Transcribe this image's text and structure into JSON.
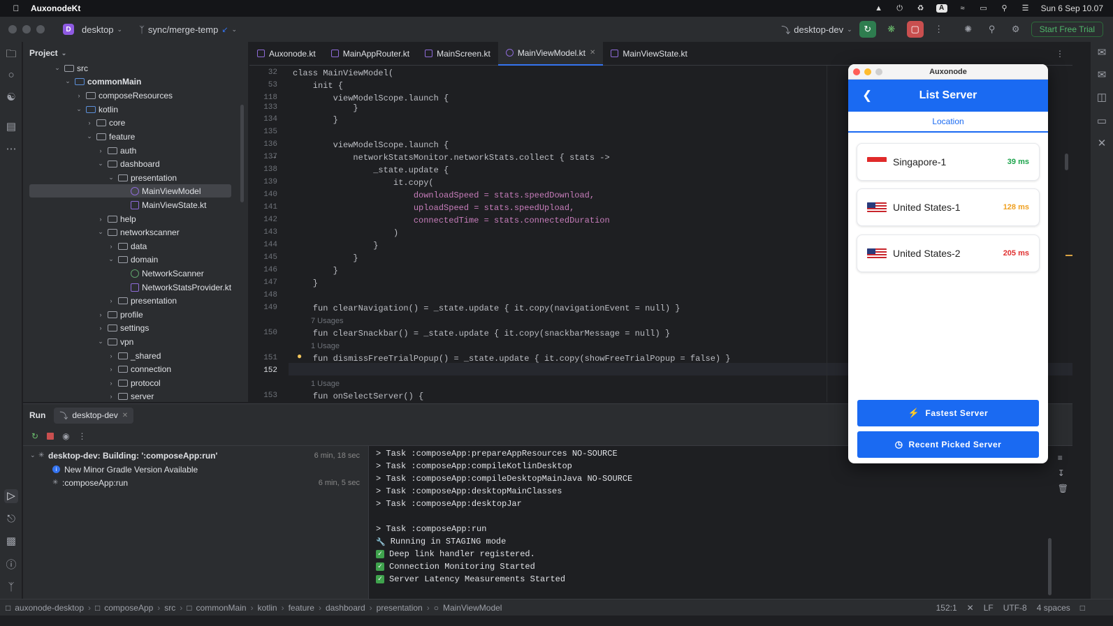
{
  "menubar": {
    "app_name": "AuxonodeKt",
    "clock": "Sun 6 Sep  10.07",
    "input_badge": "A"
  },
  "titlebar": {
    "project_badge": "D",
    "project": "desktop",
    "branch": "sync/merge-temp",
    "run_config": "desktop-dev",
    "trial_button": "Start Free Trial"
  },
  "project_panel": {
    "title": "Project",
    "tree": [
      {
        "label": "src"
      },
      {
        "label": "commonMain"
      },
      {
        "label": "composeResources"
      },
      {
        "label": "kotlin"
      },
      {
        "label": "core"
      },
      {
        "label": "feature"
      },
      {
        "label": "auth"
      },
      {
        "label": "dashboard"
      },
      {
        "label": "presentation"
      },
      {
        "label": "MainViewModel"
      },
      {
        "label": "MainViewState.kt"
      },
      {
        "label": "help"
      },
      {
        "label": "networkscanner"
      },
      {
        "label": "data"
      },
      {
        "label": "domain"
      },
      {
        "label": "NetworkScanner"
      },
      {
        "label": "NetworkStatsProvider.kt"
      },
      {
        "label": "presentation"
      },
      {
        "label": "profile"
      },
      {
        "label": "settings"
      },
      {
        "label": "vpn"
      },
      {
        "label": "_shared"
      },
      {
        "label": "connection"
      },
      {
        "label": "protocol"
      },
      {
        "label": "server"
      }
    ]
  },
  "editor": {
    "tabs": [
      {
        "label": "Auxonode.kt"
      },
      {
        "label": "MainAppRouter.kt"
      },
      {
        "label": "MainScreen.kt"
      },
      {
        "label": "MainViewModel.kt"
      },
      {
        "label": "MainViewState.kt"
      }
    ],
    "lines": [
      {
        "n": "32",
        "code": "class MainViewModel("
      },
      {
        "n": "53",
        "code": "    init {"
      },
      {
        "n": "118",
        "code": "        viewModelScope.launch {"
      },
      {
        "n": "133",
        "code": "            }"
      },
      {
        "n": "134",
        "code": "        }"
      },
      {
        "n": "135",
        "code": ""
      },
      {
        "n": "136",
        "code": "        viewModelScope.launch {"
      },
      {
        "n": "137",
        "code": "            networkStatsMonitor.networkStats.collect { stats ->"
      },
      {
        "n": "138",
        "code": "                _state.update {"
      },
      {
        "n": "139",
        "code": "                    it.copy("
      },
      {
        "n": "140",
        "code": "                        downloadSpeed = stats.speedDownload,"
      },
      {
        "n": "141",
        "code": "                        uploadSpeed = stats.speedUpload,"
      },
      {
        "n": "142",
        "code": "                        connectedTime = stats.connectedDuration"
      },
      {
        "n": "143",
        "code": "                    )"
      },
      {
        "n": "144",
        "code": "                }"
      },
      {
        "n": "145",
        "code": "            }"
      },
      {
        "n": "146",
        "code": "        }"
      },
      {
        "n": "147",
        "code": "    }"
      },
      {
        "n": "148",
        "code": ""
      },
      {
        "n": "149",
        "code": "    fun clearNavigation() = _state.update { it.copy(navigationEvent = null) }"
      },
      {
        "n": "150",
        "code": "    fun clearSnackbar() = _state.update { it.copy(snackbarMessage = null) }"
      },
      {
        "n": "151",
        "code": "    fun dismissFreeTrialPopup() = _state.update { it.copy(showFreeTrialPopup = false) }"
      },
      {
        "n": "152",
        "code": ""
      },
      {
        "n": "153",
        "code": "    fun onSelectServer() {"
      }
    ],
    "hints": {
      "h150": "7 Usages",
      "h151": "1 Usage",
      "h153": "1 Usage"
    }
  },
  "run_panel": {
    "title": "Run",
    "tab": "desktop-dev",
    "tree": [
      {
        "label": "desktop-dev: Building: ':composeApp:run'",
        "time": "6 min, 18 sec"
      },
      {
        "label": "New Minor Gradle Version Available",
        "time": ""
      },
      {
        "label": ":composeApp:run",
        "time": "6 min, 5 sec"
      }
    ],
    "console": [
      {
        "text": "> Task :composeApp:prepareAppResources NO-SOURCE"
      },
      {
        "text": "> Task :composeApp:compileKotlinDesktop"
      },
      {
        "text": "> Task :composeApp:compileDesktopMainJava NO-SOURCE"
      },
      {
        "text": "> Task :composeApp:desktopMainClasses"
      },
      {
        "text": "> Task :composeApp:desktopJar"
      },
      {
        "text": ""
      },
      {
        "text": "> Task :composeApp:run"
      },
      {
        "text": "Running in STAGING mode",
        "icon": "wrench"
      },
      {
        "text": "Deep link handler registered.",
        "icon": "check"
      },
      {
        "text": "Connection Monitoring Started",
        "icon": "check"
      },
      {
        "text": "Server Latency Measurements Started",
        "icon": "check"
      }
    ]
  },
  "statusbar": {
    "crumbs": [
      "auxonode-desktop",
      "composeApp",
      "src",
      "commonMain",
      "kotlin",
      "feature",
      "dashboard",
      "presentation",
      "MainViewModel"
    ],
    "position": "152:1",
    "line_sep": "LF",
    "encoding": "UTF-8",
    "indent": "4 spaces"
  },
  "app_window": {
    "title": "Auxonode",
    "header": "List Server",
    "tab": "Location",
    "servers": [
      {
        "name": "Singapore-1",
        "latency": "39 ms",
        "color": "#1aa34a",
        "flag": "sg"
      },
      {
        "name": "United States-1",
        "latency": "128 ms",
        "color": "#f0a020",
        "flag": "us"
      },
      {
        "name": "United States-2",
        "latency": "205 ms",
        "color": "#e03030",
        "flag": "us"
      }
    ],
    "fastest_button": "Fastest Server",
    "recent_button": "Recent Picked Server",
    "accent": "#1a6af2"
  }
}
